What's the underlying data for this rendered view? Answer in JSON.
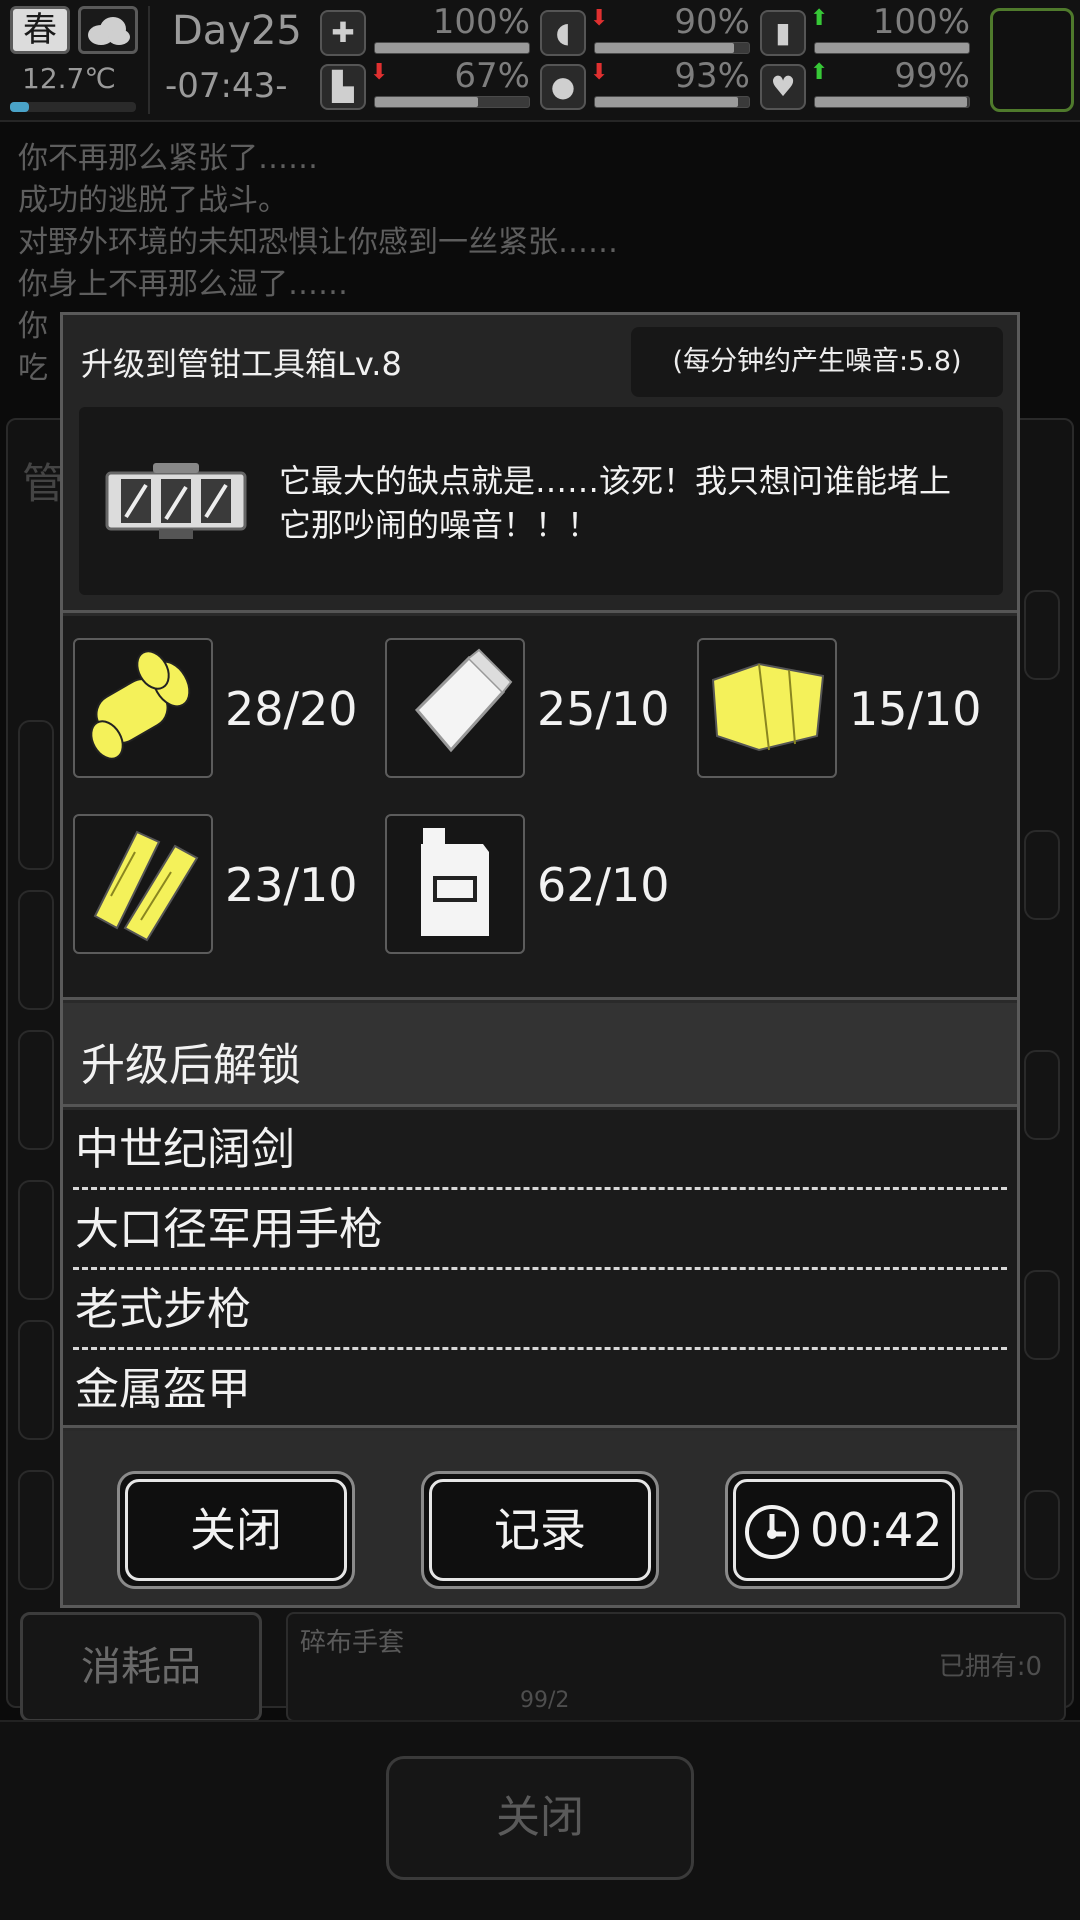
{
  "status": {
    "season": "春",
    "temperature": "12.7℃",
    "temperature_level": 0.15,
    "day": "Day25",
    "time": "-07:43-",
    "stats": [
      {
        "name": "health",
        "icon": "medkit-icon",
        "glyph": "✚",
        "value": "100%",
        "level": 1.0,
        "arrow": ""
      },
      {
        "name": "hunger",
        "icon": "stomach-icon",
        "glyph": "◖",
        "value": "90%",
        "level": 0.9,
        "arrow": "down"
      },
      {
        "name": "energy",
        "icon": "battery-icon",
        "glyph": "▮",
        "value": "100%",
        "level": 1.0,
        "arrow": "up"
      },
      {
        "name": "stamina",
        "icon": "boot-icon",
        "glyph": "▙",
        "value": "67%",
        "level": 0.67,
        "arrow": "down"
      },
      {
        "name": "thirst",
        "icon": "water-drop-icon",
        "glyph": "●",
        "value": "93%",
        "level": 0.93,
        "arrow": "down"
      },
      {
        "name": "mood",
        "icon": "heart-icon",
        "glyph": "♥",
        "value": "99%",
        "level": 0.99,
        "arrow": "up"
      }
    ]
  },
  "log": [
    "你不再那么紧张了……",
    "成功的逃脱了战斗。",
    "对野外环境的未知恐惧让你感到一丝紧张……",
    "你身上不再那么湿了……",
    "你",
    "吃"
  ],
  "background": {
    "title": "管",
    "consumables_label": "消耗品",
    "item_name": "碎布手套",
    "item_owned": "已拥有:0",
    "item_count": "99/2",
    "close_label": "关闭"
  },
  "modal": {
    "title": "升级到管钳工具箱Lv.8",
    "noise": "(每分钟约产生噪音:5.8)",
    "description": "它最大的缺点就是……该死！我只想问谁能堵上它那吵闹的噪音！！！",
    "materials": [
      {
        "icon": "rubber-hose-icon",
        "count": "28/20"
      },
      {
        "icon": "plastic-bag-icon",
        "count": "25/10"
      },
      {
        "icon": "cloth-icon",
        "count": "15/10"
      },
      {
        "icon": "wood-planks-icon",
        "count": "23/10"
      },
      {
        "icon": "fuel-canister-icon",
        "count": "62/10"
      }
    ],
    "unlock_title": "升级后解锁",
    "unlocks": [
      "中世纪阔剑",
      "大口径军用手枪",
      "老式步枪",
      "金属盔甲"
    ],
    "buttons": {
      "close": "关闭",
      "record": "记录",
      "timer": "00:42"
    }
  }
}
